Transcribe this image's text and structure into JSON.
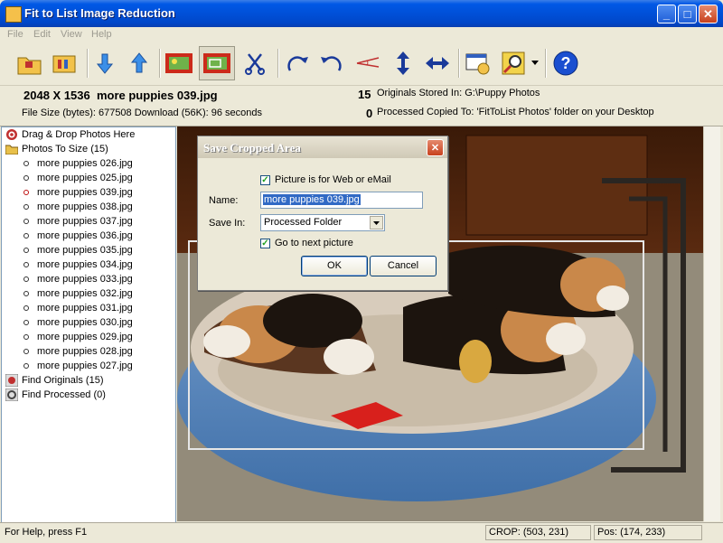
{
  "window": {
    "title": "Fit to List Image Reduction",
    "min_glyph": "_",
    "max_glyph": "□",
    "close_glyph": "✕"
  },
  "menu": [
    "File",
    "Edit",
    "View",
    "Help"
  ],
  "toolbar": {
    "icons": [
      "open-folder-icon",
      "properties-icon",
      "arrow-down-icon",
      "arrow-up-icon",
      "fit-image-icon",
      "crop-image-icon",
      "scissors-icon",
      "rotate-right-icon",
      "rotate-left-icon",
      "angle-tool-icon",
      "flip-vertical-icon",
      "flip-horizontal-icon",
      "settings-icon",
      "search-icon",
      "help-icon"
    ]
  },
  "info": {
    "dimensions": "2048 X 1536",
    "filename": "more puppies 039.jpg",
    "file_size": "File Size (bytes): 677508  Download (56K): 96 seconds",
    "originals_count": "15",
    "originals_text": "Originals Stored In: G:\\Puppy Photos",
    "processed_count": "0",
    "processed_text": "Processed Copied To: 'FitToList Photos' folder on your Desktop"
  },
  "tree": {
    "drag_drop": "Drag & Drop Photos Here",
    "photos_to_size": "Photos To Size (15)",
    "files": [
      "more puppies 026.jpg",
      "more puppies 025.jpg",
      "more puppies 039.jpg",
      "more puppies 038.jpg",
      "more puppies 037.jpg",
      "more puppies 036.jpg",
      "more puppies 035.jpg",
      "more puppies 034.jpg",
      "more puppies 033.jpg",
      "more puppies 032.jpg",
      "more puppies 031.jpg",
      "more puppies 030.jpg",
      "more puppies 029.jpg",
      "more puppies 028.jpg",
      "more puppies 027.jpg"
    ],
    "selected_index": 2,
    "find_originals": "Find Originals (15)",
    "find_processed": "Find Processed (0)"
  },
  "dialog": {
    "title": "Save Cropped Area",
    "web_email_label": "Picture is for Web or eMail",
    "web_email_checked": true,
    "name_label": "Name:",
    "name_value": "more puppies 039.jpg",
    "save_in_label": "Save In:",
    "save_in_value": "Processed Folder",
    "next_label": "Go to next picture",
    "next_checked": true,
    "ok_label": "OK",
    "cancel_label": "Cancel",
    "check_glyph": "✓",
    "close_glyph": "✕"
  },
  "status": {
    "help": "For Help, press F1",
    "crop": "CROP: (503, 231)",
    "pos": "Pos: (174, 233)"
  },
  "colors": {
    "titlebar": "#0050d8",
    "panel_border": "#7f9db9",
    "selection": "#316ac5"
  }
}
